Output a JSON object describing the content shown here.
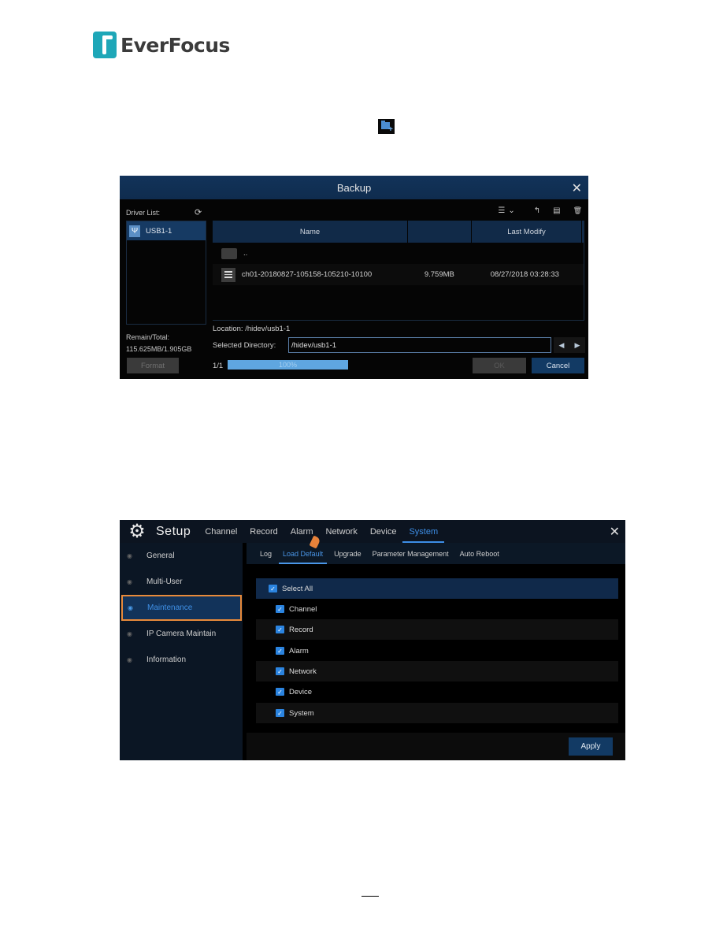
{
  "logo": {
    "brand": "EverFocus",
    "brand_color": "#1ea7b8"
  },
  "inline_icon": {
    "name": "add-folder-icon"
  },
  "backup": {
    "title": "Backup",
    "driver_list_label": "Driver List:",
    "drivers": [
      {
        "label": "USB1-1"
      }
    ],
    "remain_label": "Remain/Total:",
    "remain_value": "115.625MB/1.905GB",
    "format_button": "Format",
    "toolbar": {
      "view_icon": "☰",
      "dropdown_icon": "⌄",
      "back_icon": "↰",
      "new_folder_icon": "▤",
      "delete_icon": "🗑"
    },
    "columns": [
      "Name",
      "",
      "Last Modify"
    ],
    "rows": [
      {
        "type": "folder",
        "name": "..",
        "size": "",
        "modified": ""
      },
      {
        "type": "file",
        "name": "ch01-20180827-105158-105210-10100",
        "size": "9.759MB",
        "modified": "08/27/2018 03:28:33"
      }
    ],
    "location": "Location: /hidev/usb1-1",
    "selected_dir_label": "Selected Directory:",
    "selected_dir_value": "/hidev/usb1-1",
    "page_indicator": "1/1",
    "progress_percent": 100,
    "progress_label": "100%",
    "ok_button": "OK",
    "cancel_button": "Cancel"
  },
  "setup": {
    "title": "Setup",
    "tabs": [
      {
        "label": "Channel",
        "active": false
      },
      {
        "label": "Record",
        "active": false
      },
      {
        "label": "Alarm",
        "active": false
      },
      {
        "label": "Network",
        "active": false
      },
      {
        "label": "Device",
        "active": false
      },
      {
        "label": "System",
        "active": true
      }
    ],
    "sidebar": [
      {
        "label": "General",
        "active": false
      },
      {
        "label": "Multi-User",
        "active": false
      },
      {
        "label": "Maintenance",
        "active": true
      },
      {
        "label": "IP Camera Maintain",
        "active": false
      },
      {
        "label": "Information",
        "active": false
      }
    ],
    "subtabs": [
      {
        "label": "Log",
        "active": false
      },
      {
        "label": "Load Default",
        "active": true
      },
      {
        "label": "Upgrade",
        "active": false
      },
      {
        "label": "Parameter Management",
        "active": false
      },
      {
        "label": "Auto Reboot",
        "active": false
      }
    ],
    "options": [
      {
        "label": "Select All",
        "checked": true
      },
      {
        "label": "Channel",
        "checked": true
      },
      {
        "label": "Record",
        "checked": true
      },
      {
        "label": "Alarm",
        "checked": true
      },
      {
        "label": "Network",
        "checked": true
      },
      {
        "label": "Device",
        "checked": true
      },
      {
        "label": "System",
        "checked": true
      }
    ],
    "apply_button": "Apply",
    "accent_color": "#3d8ee6",
    "highlight_color": "#e88a3a"
  }
}
